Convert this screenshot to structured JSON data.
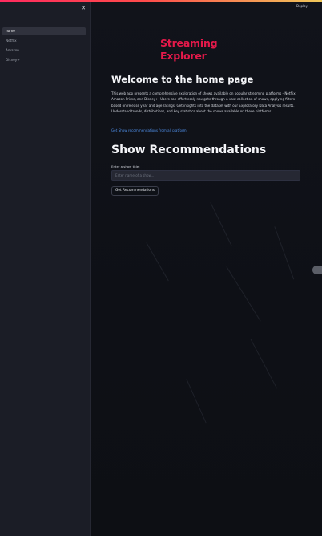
{
  "header": {
    "deploy_label": "Deploy"
  },
  "sidebar": {
    "close_icon": "close-icon",
    "items": [
      {
        "label": "home",
        "active": true
      },
      {
        "label": "Netflix"
      },
      {
        "label": "Amazon"
      },
      {
        "label": "Disney+"
      }
    ]
  },
  "main": {
    "logo_line1": "Streaming",
    "logo_line2": "Explorer",
    "welcome_title": "Welcome to the home page",
    "description": "This web app presents a comprehensive exploration of shows available on popular streaming platforms - Netflix, Amazon Prime, and Disney+. Users can effortlessly navigate through a vast collection of shows, applying filters based on release year and age ratings. Get insights into the dataset with our Exploratory Data Analysis results. Understand trends, distributions, and key statistics about the shows available on these platforms.",
    "link_text": "Get Show recommendations from all platform",
    "recs_title": "Show Recommendations",
    "input_label": "Enter a show title:",
    "input_placeholder": "Enter name of a show...",
    "button_label": "Get Recommendations"
  },
  "colors": {
    "accent": "#e5194a",
    "link": "#4f8fe8",
    "background": "#0e1117",
    "sidebar": "#1b1d26"
  }
}
